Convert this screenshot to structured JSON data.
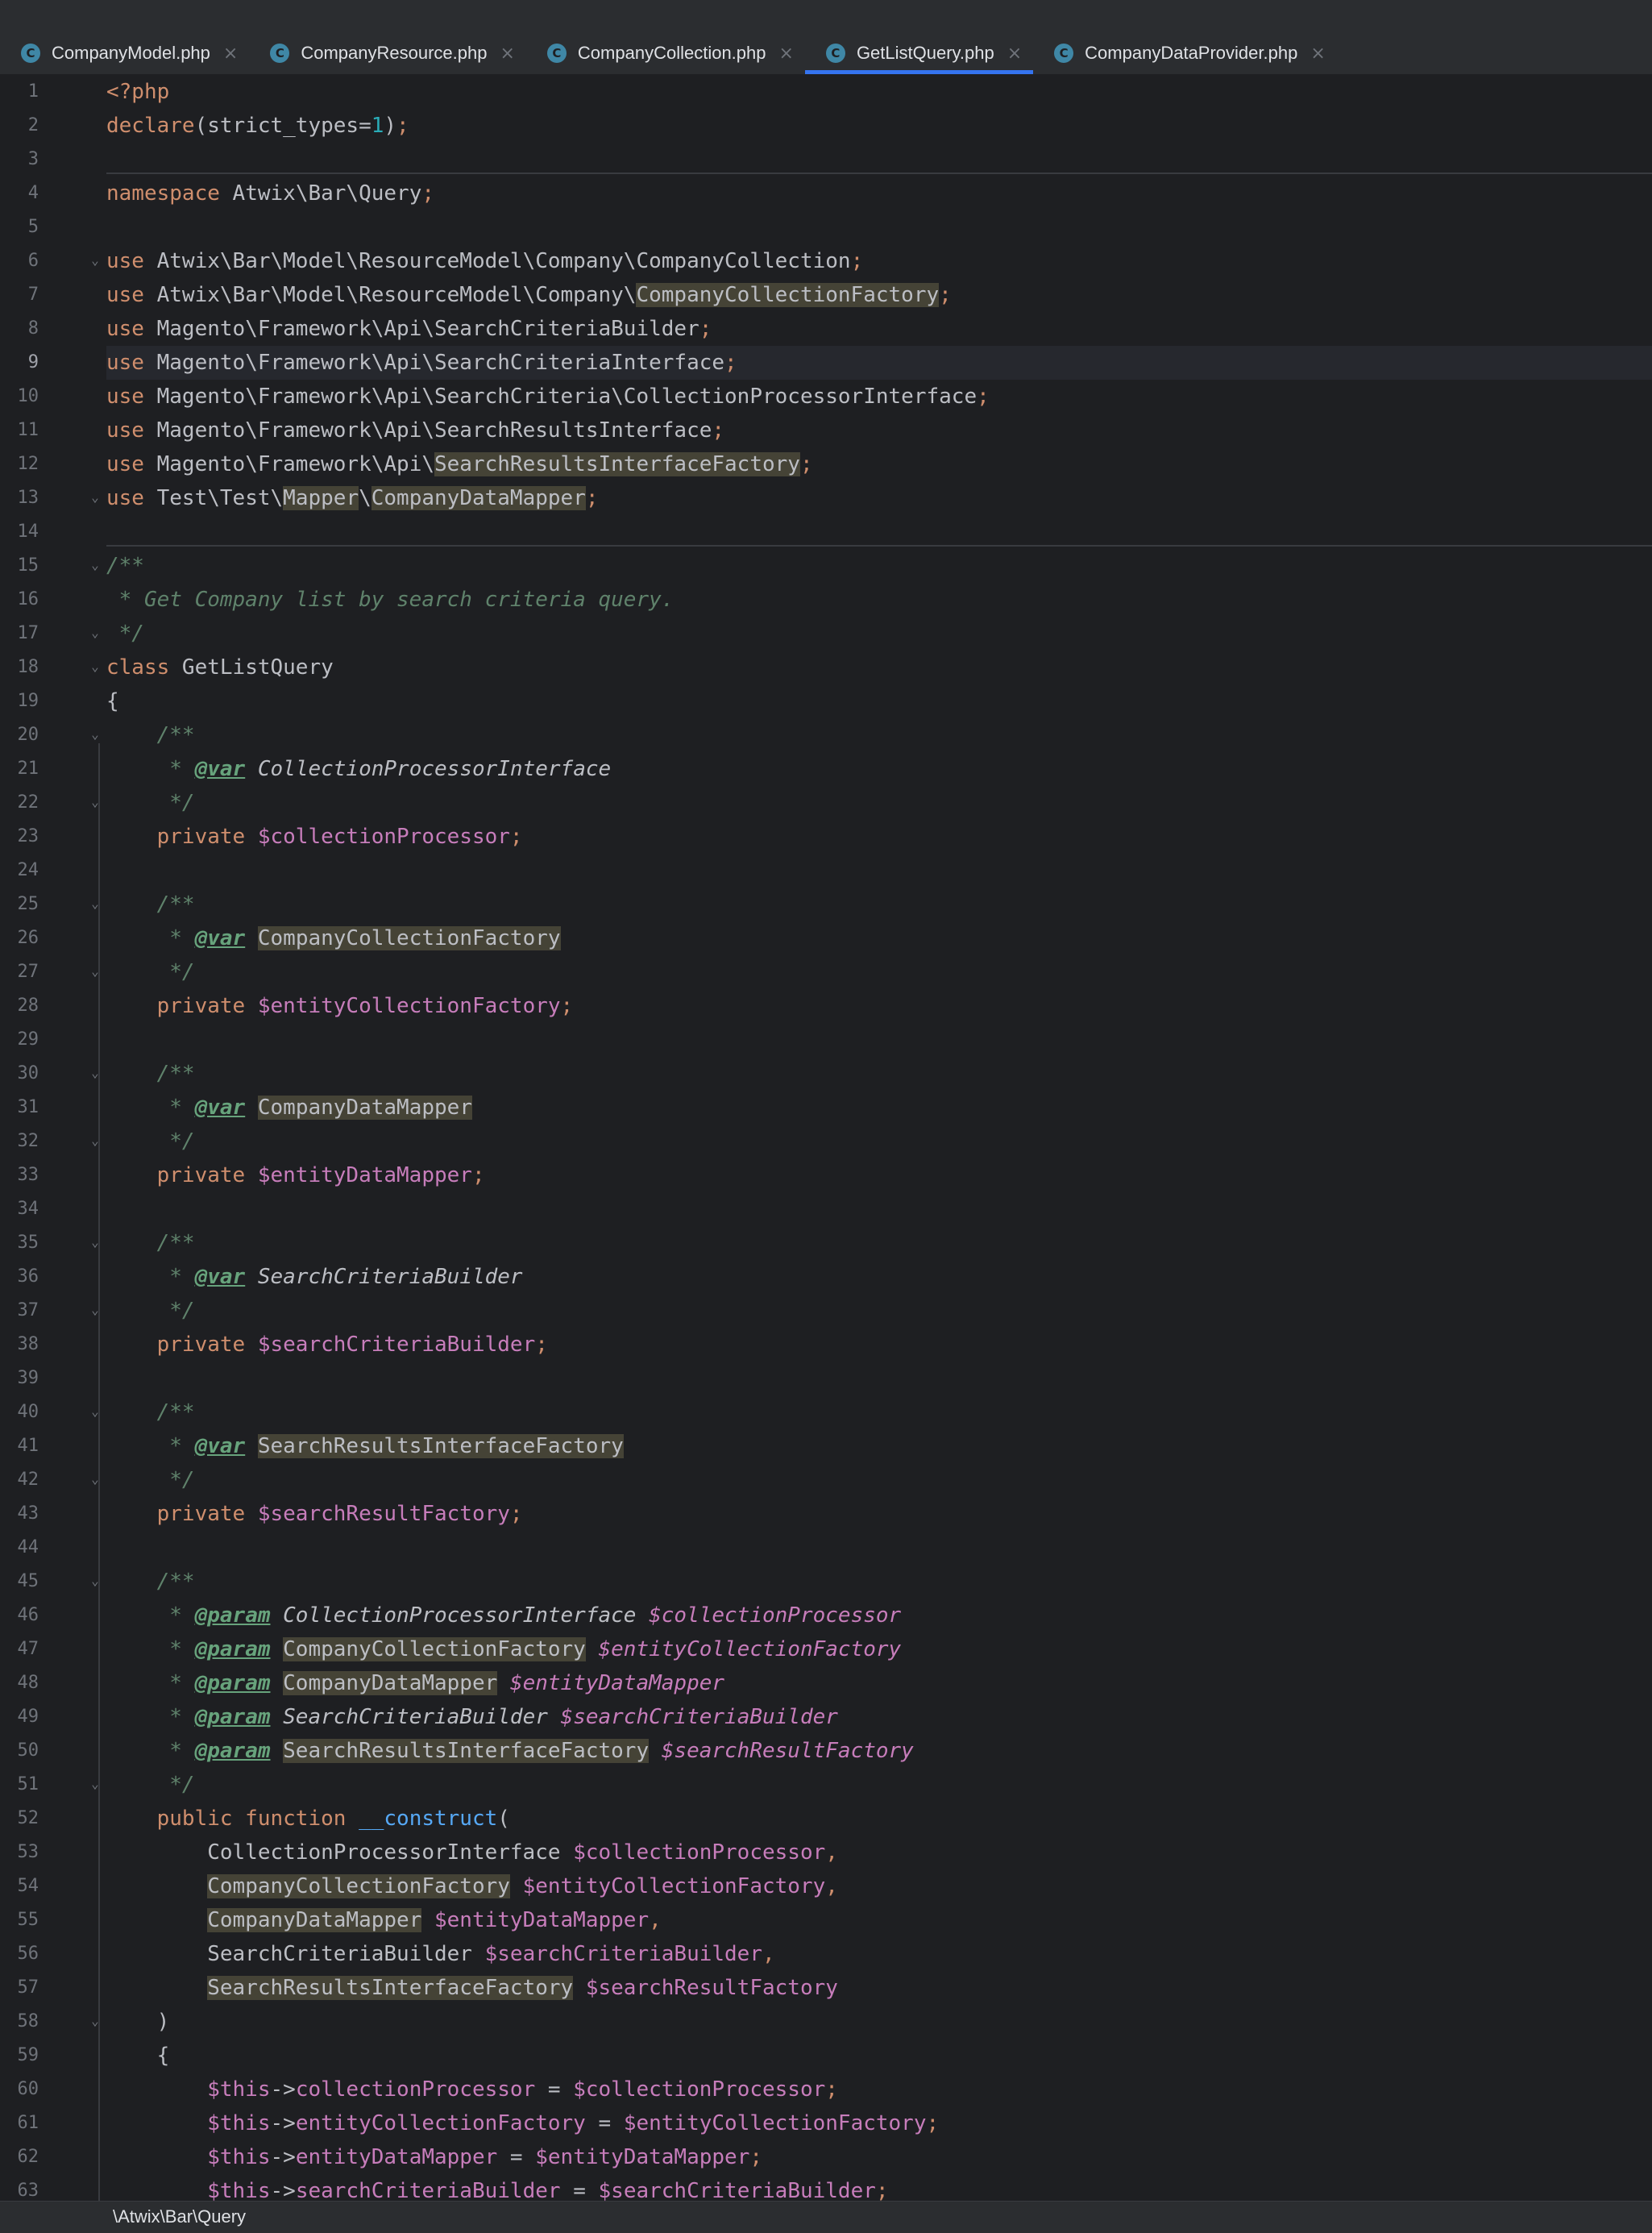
{
  "tabs": [
    {
      "label": "CompanyModel.php",
      "active": false
    },
    {
      "label": "CompanyResource.php",
      "active": false
    },
    {
      "label": "CompanyCollection.php",
      "active": false
    },
    {
      "label": "GetListQuery.php",
      "active": true
    },
    {
      "label": "CompanyDataProvider.php",
      "active": false
    }
  ],
  "tab_icon_glyph": "C",
  "close_glyph": "×",
  "editor": {
    "current_line": 9,
    "lines": [
      [
        [
          "kw",
          "<?php"
        ]
      ],
      [
        [
          "kw",
          "declare"
        ],
        [
          "plain",
          "(strict_types="
        ],
        [
          "num",
          "1"
        ],
        [
          "plain",
          ")"
        ],
        [
          "semi",
          ";"
        ]
      ],
      [],
      [
        [
          "kw",
          "namespace "
        ],
        [
          "plain",
          "Atwix\\Bar\\Query"
        ],
        [
          "semi",
          ";"
        ]
      ],
      [],
      [
        [
          "kw",
          "use "
        ],
        [
          "plain",
          "Atwix\\Bar\\Model\\ResourceModel\\Company\\CompanyCollection"
        ],
        [
          "semi",
          ";"
        ]
      ],
      [
        [
          "kw",
          "use "
        ],
        [
          "plain",
          "Atwix\\Bar\\Model\\ResourceModel\\Company\\"
        ],
        [
          "hl",
          "CompanyCollectionFactory"
        ],
        [
          "semi",
          ";"
        ]
      ],
      [
        [
          "kw",
          "use "
        ],
        [
          "plain",
          "Magento\\Framework\\Api\\SearchCriteriaBuilder"
        ],
        [
          "semi",
          ";"
        ]
      ],
      [
        [
          "kw",
          "use "
        ],
        [
          "plain",
          "Magento\\Framework\\Api\\SearchCriteriaInterface"
        ],
        [
          "semi",
          ";"
        ]
      ],
      [
        [
          "kw",
          "use "
        ],
        [
          "plain",
          "Magento\\Framework\\Api\\SearchCriteria\\CollectionProcessorInterface"
        ],
        [
          "semi",
          ";"
        ]
      ],
      [
        [
          "kw",
          "use "
        ],
        [
          "plain",
          "Magento\\Framework\\Api\\SearchResultsInterface"
        ],
        [
          "semi",
          ";"
        ]
      ],
      [
        [
          "kw",
          "use "
        ],
        [
          "plain",
          "Magento\\Framework\\Api\\"
        ],
        [
          "hl",
          "SearchResultsInterfaceFactory"
        ],
        [
          "semi",
          ";"
        ]
      ],
      [
        [
          "kw",
          "use "
        ],
        [
          "plain",
          "Test\\Test\\"
        ],
        [
          "hl",
          "Mapper"
        ],
        [
          "plain",
          "\\"
        ],
        [
          "hl",
          "CompanyDataMapper"
        ],
        [
          "semi",
          ";"
        ]
      ],
      [],
      [
        [
          "doc",
          "/**"
        ]
      ],
      [
        [
          "doc",
          " * Get Company list by search criteria query."
        ]
      ],
      [
        [
          "doc",
          " */"
        ]
      ],
      [
        [
          "kw",
          "class "
        ],
        [
          "plain",
          "GetListQuery"
        ]
      ],
      [
        [
          "plain",
          "{"
        ]
      ],
      [
        [
          "doc",
          "    /**"
        ]
      ],
      [
        [
          "doc",
          "     * "
        ],
        [
          "doctag",
          "@var"
        ],
        [
          "doc",
          " "
        ],
        [
          "doctype",
          "CollectionProcessorInterface"
        ]
      ],
      [
        [
          "doc",
          "     */"
        ]
      ],
      [
        [
          "kw",
          "    private "
        ],
        [
          "var",
          "$collectionProcessor"
        ],
        [
          "semi",
          ";"
        ]
      ],
      [],
      [
        [
          "doc",
          "    /**"
        ]
      ],
      [
        [
          "doc",
          "     * "
        ],
        [
          "doctag",
          "@var"
        ],
        [
          "doc",
          " "
        ],
        [
          "hl",
          "CompanyCollectionFactory"
        ]
      ],
      [
        [
          "doc",
          "     */"
        ]
      ],
      [
        [
          "kw",
          "    private "
        ],
        [
          "var",
          "$entityCollectionFactory"
        ],
        [
          "semi",
          ";"
        ]
      ],
      [],
      [
        [
          "doc",
          "    /**"
        ]
      ],
      [
        [
          "doc",
          "     * "
        ],
        [
          "doctag",
          "@var"
        ],
        [
          "doc",
          " "
        ],
        [
          "hl",
          "CompanyDataMapper"
        ]
      ],
      [
        [
          "doc",
          "     */"
        ]
      ],
      [
        [
          "kw",
          "    private "
        ],
        [
          "var",
          "$entityDataMapper"
        ],
        [
          "semi",
          ";"
        ]
      ],
      [],
      [
        [
          "doc",
          "    /**"
        ]
      ],
      [
        [
          "doc",
          "     * "
        ],
        [
          "doctag",
          "@var"
        ],
        [
          "doc",
          " "
        ],
        [
          "doctype",
          "SearchCriteriaBuilder"
        ]
      ],
      [
        [
          "doc",
          "     */"
        ]
      ],
      [
        [
          "kw",
          "    private "
        ],
        [
          "var",
          "$searchCriteriaBuilder"
        ],
        [
          "semi",
          ";"
        ]
      ],
      [],
      [
        [
          "doc",
          "    /**"
        ]
      ],
      [
        [
          "doc",
          "     * "
        ],
        [
          "doctag",
          "@var"
        ],
        [
          "doc",
          " "
        ],
        [
          "hl",
          "SearchResultsInterfaceFactory"
        ]
      ],
      [
        [
          "doc",
          "     */"
        ]
      ],
      [
        [
          "kw",
          "    private "
        ],
        [
          "var",
          "$searchResultFactory"
        ],
        [
          "semi",
          ";"
        ]
      ],
      [],
      [
        [
          "doc",
          "    /**"
        ]
      ],
      [
        [
          "doc",
          "     * "
        ],
        [
          "doctag",
          "@param"
        ],
        [
          "doc",
          " "
        ],
        [
          "doctype",
          "CollectionProcessorInterface"
        ],
        [
          "doc",
          " "
        ],
        [
          "docvar",
          "$collectionProcessor"
        ]
      ],
      [
        [
          "doc",
          "     * "
        ],
        [
          "doctag",
          "@param"
        ],
        [
          "doc",
          " "
        ],
        [
          "hl",
          "CompanyCollectionFactory"
        ],
        [
          "doc",
          " "
        ],
        [
          "docvar",
          "$entityCollectionFactory"
        ]
      ],
      [
        [
          "doc",
          "     * "
        ],
        [
          "doctag",
          "@param"
        ],
        [
          "doc",
          " "
        ],
        [
          "hl",
          "CompanyDataMapper"
        ],
        [
          "doc",
          " "
        ],
        [
          "docvar",
          "$entityDataMapper"
        ]
      ],
      [
        [
          "doc",
          "     * "
        ],
        [
          "doctag",
          "@param"
        ],
        [
          "doc",
          " "
        ],
        [
          "doctype",
          "SearchCriteriaBuilder"
        ],
        [
          "doc",
          " "
        ],
        [
          "docvar",
          "$searchCriteriaBuilder"
        ]
      ],
      [
        [
          "doc",
          "     * "
        ],
        [
          "doctag",
          "@param"
        ],
        [
          "doc",
          " "
        ],
        [
          "hl",
          "SearchResultsInterfaceFactory"
        ],
        [
          "doc",
          " "
        ],
        [
          "docvar",
          "$searchResultFactory"
        ]
      ],
      [
        [
          "doc",
          "     */"
        ]
      ],
      [
        [
          "kw",
          "    public function "
        ],
        [
          "fn",
          "__construct"
        ],
        [
          "plain",
          "("
        ]
      ],
      [
        [
          "plain",
          "        CollectionProcessorInterface "
        ],
        [
          "var",
          "$collectionProcessor"
        ],
        [
          "semi",
          ","
        ]
      ],
      [
        [
          "plain",
          "        "
        ],
        [
          "hl",
          "CompanyCollectionFactory"
        ],
        [
          "plain",
          " "
        ],
        [
          "var",
          "$entityCollectionFactory"
        ],
        [
          "semi",
          ","
        ]
      ],
      [
        [
          "plain",
          "        "
        ],
        [
          "hl",
          "CompanyDataMapper"
        ],
        [
          "plain",
          " "
        ],
        [
          "var",
          "$entityDataMapper"
        ],
        [
          "semi",
          ","
        ]
      ],
      [
        [
          "plain",
          "        SearchCriteriaBuilder "
        ],
        [
          "var",
          "$searchCriteriaBuilder"
        ],
        [
          "semi",
          ","
        ]
      ],
      [
        [
          "plain",
          "        "
        ],
        [
          "hl",
          "SearchResultsInterfaceFactory"
        ],
        [
          "plain",
          " "
        ],
        [
          "var",
          "$searchResultFactory"
        ]
      ],
      [
        [
          "plain",
          "    )"
        ]
      ],
      [
        [
          "plain",
          "    {"
        ]
      ],
      [
        [
          "var",
          "        $this"
        ],
        [
          "plain",
          "->"
        ],
        [
          "var",
          "collectionProcessor"
        ],
        [
          "plain",
          " = "
        ],
        [
          "var",
          "$collectionProcessor"
        ],
        [
          "semi",
          ";"
        ]
      ],
      [
        [
          "var",
          "        $this"
        ],
        [
          "plain",
          "->"
        ],
        [
          "var",
          "entityCollectionFactory"
        ],
        [
          "plain",
          " = "
        ],
        [
          "var",
          "$entityCollectionFactory"
        ],
        [
          "semi",
          ";"
        ]
      ],
      [
        [
          "var",
          "        $this"
        ],
        [
          "plain",
          "->"
        ],
        [
          "var",
          "entityDataMapper"
        ],
        [
          "plain",
          " = "
        ],
        [
          "var",
          "$entityDataMapper"
        ],
        [
          "semi",
          ";"
        ]
      ],
      [
        [
          "var",
          "        $this"
        ],
        [
          "plain",
          "->"
        ],
        [
          "var",
          "searchCriteriaBuilder"
        ],
        [
          "plain",
          " = "
        ],
        [
          "var",
          "$searchCriteriaBuilder"
        ],
        [
          "semi",
          ";"
        ]
      ]
    ],
    "fold_lines": [
      6,
      13,
      15,
      17,
      18,
      20,
      22,
      25,
      27,
      30,
      32,
      35,
      37,
      40,
      42,
      45,
      51,
      58
    ]
  },
  "status_breadcrumb": "\\Atwix\\Bar\\Query",
  "colors": {
    "background": "#1e1f22",
    "keyword": "#cf8e6d",
    "variable": "#c77dbb",
    "comment": "#5f826b",
    "number": "#2aacb8",
    "highlight": "#454336",
    "active_tab_underline": "#3574f0"
  }
}
